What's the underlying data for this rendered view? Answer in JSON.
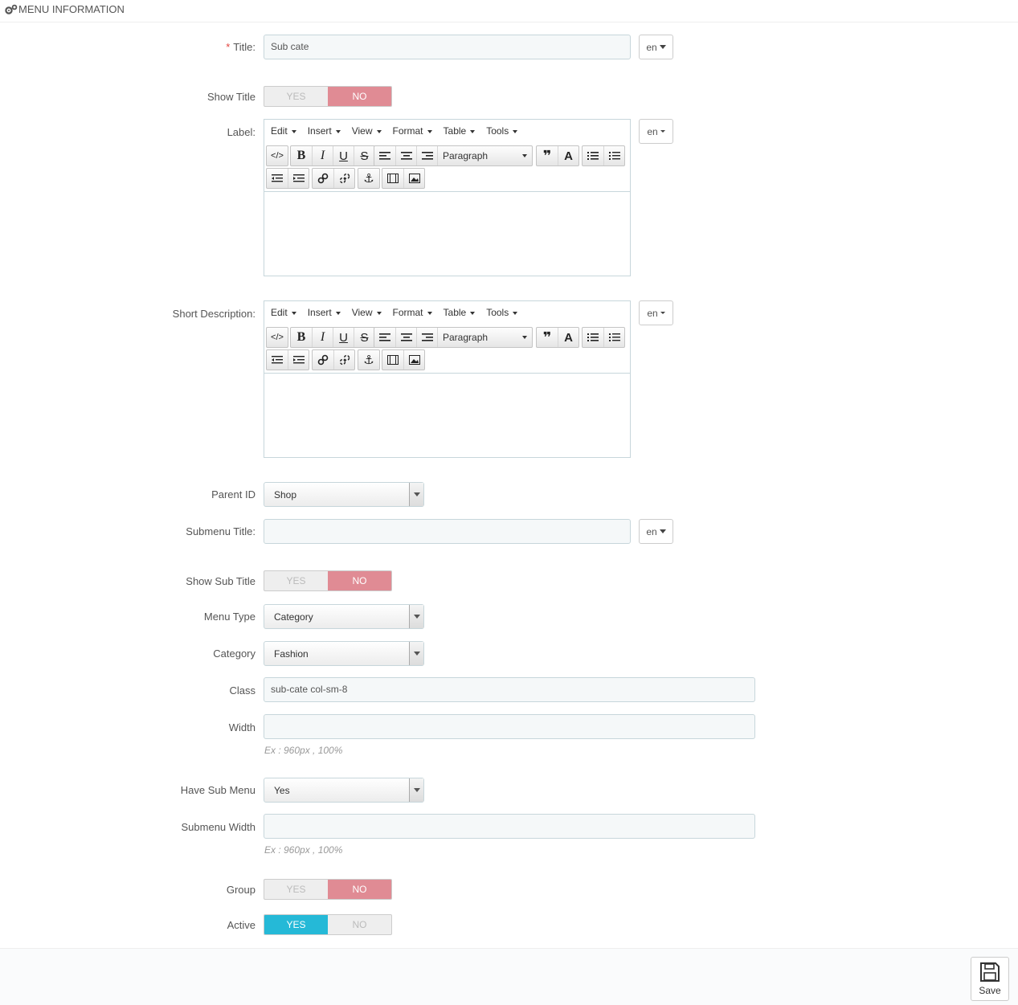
{
  "panel": {
    "title": "MENU INFORMATION",
    "icon": "cogs-icon"
  },
  "fields": {
    "title": {
      "required_mark": "*",
      "label": "Title:",
      "value": "Sub cate",
      "lang": "en"
    },
    "show_title": {
      "label": "Show Title",
      "yes": "YES",
      "no": "NO",
      "selected": "NO"
    },
    "label": {
      "label": "Label:",
      "lang": "en"
    },
    "short_description": {
      "label": "Short Description:",
      "lang": "en"
    },
    "parent_id": {
      "label": "Parent ID",
      "value": "Shop"
    },
    "submenu_title": {
      "label": "Submenu Title:",
      "value": "",
      "lang": "en"
    },
    "show_sub_title": {
      "label": "Show Sub Title",
      "yes": "YES",
      "no": "NO",
      "selected": "NO"
    },
    "menu_type": {
      "label": "Menu Type",
      "value": "Category"
    },
    "category": {
      "label": "Category",
      "value": "Fashion"
    },
    "class": {
      "label": "Class",
      "value": "sub-cate col-sm-8"
    },
    "width": {
      "label": "Width",
      "value": "",
      "help": "Ex : 960px , 100%"
    },
    "have_sub_menu": {
      "label": "Have Sub Menu",
      "value": "Yes"
    },
    "submenu_width": {
      "label": "Submenu Width",
      "value": "",
      "help": "Ex : 960px , 100%"
    },
    "group": {
      "label": "Group",
      "yes": "YES",
      "no": "NO",
      "selected": "NO"
    },
    "active": {
      "label": "Active",
      "yes": "YES",
      "no": "NO",
      "selected": "YES"
    }
  },
  "editor": {
    "menus": [
      "Edit",
      "Insert",
      "View",
      "Format",
      "Table",
      "Tools"
    ],
    "block_format": "Paragraph"
  },
  "footer": {
    "save_label": "Save"
  },
  "colors": {
    "no_active": "#e08b94",
    "yes_active": "#25b9d7",
    "required": "#e3453f"
  }
}
